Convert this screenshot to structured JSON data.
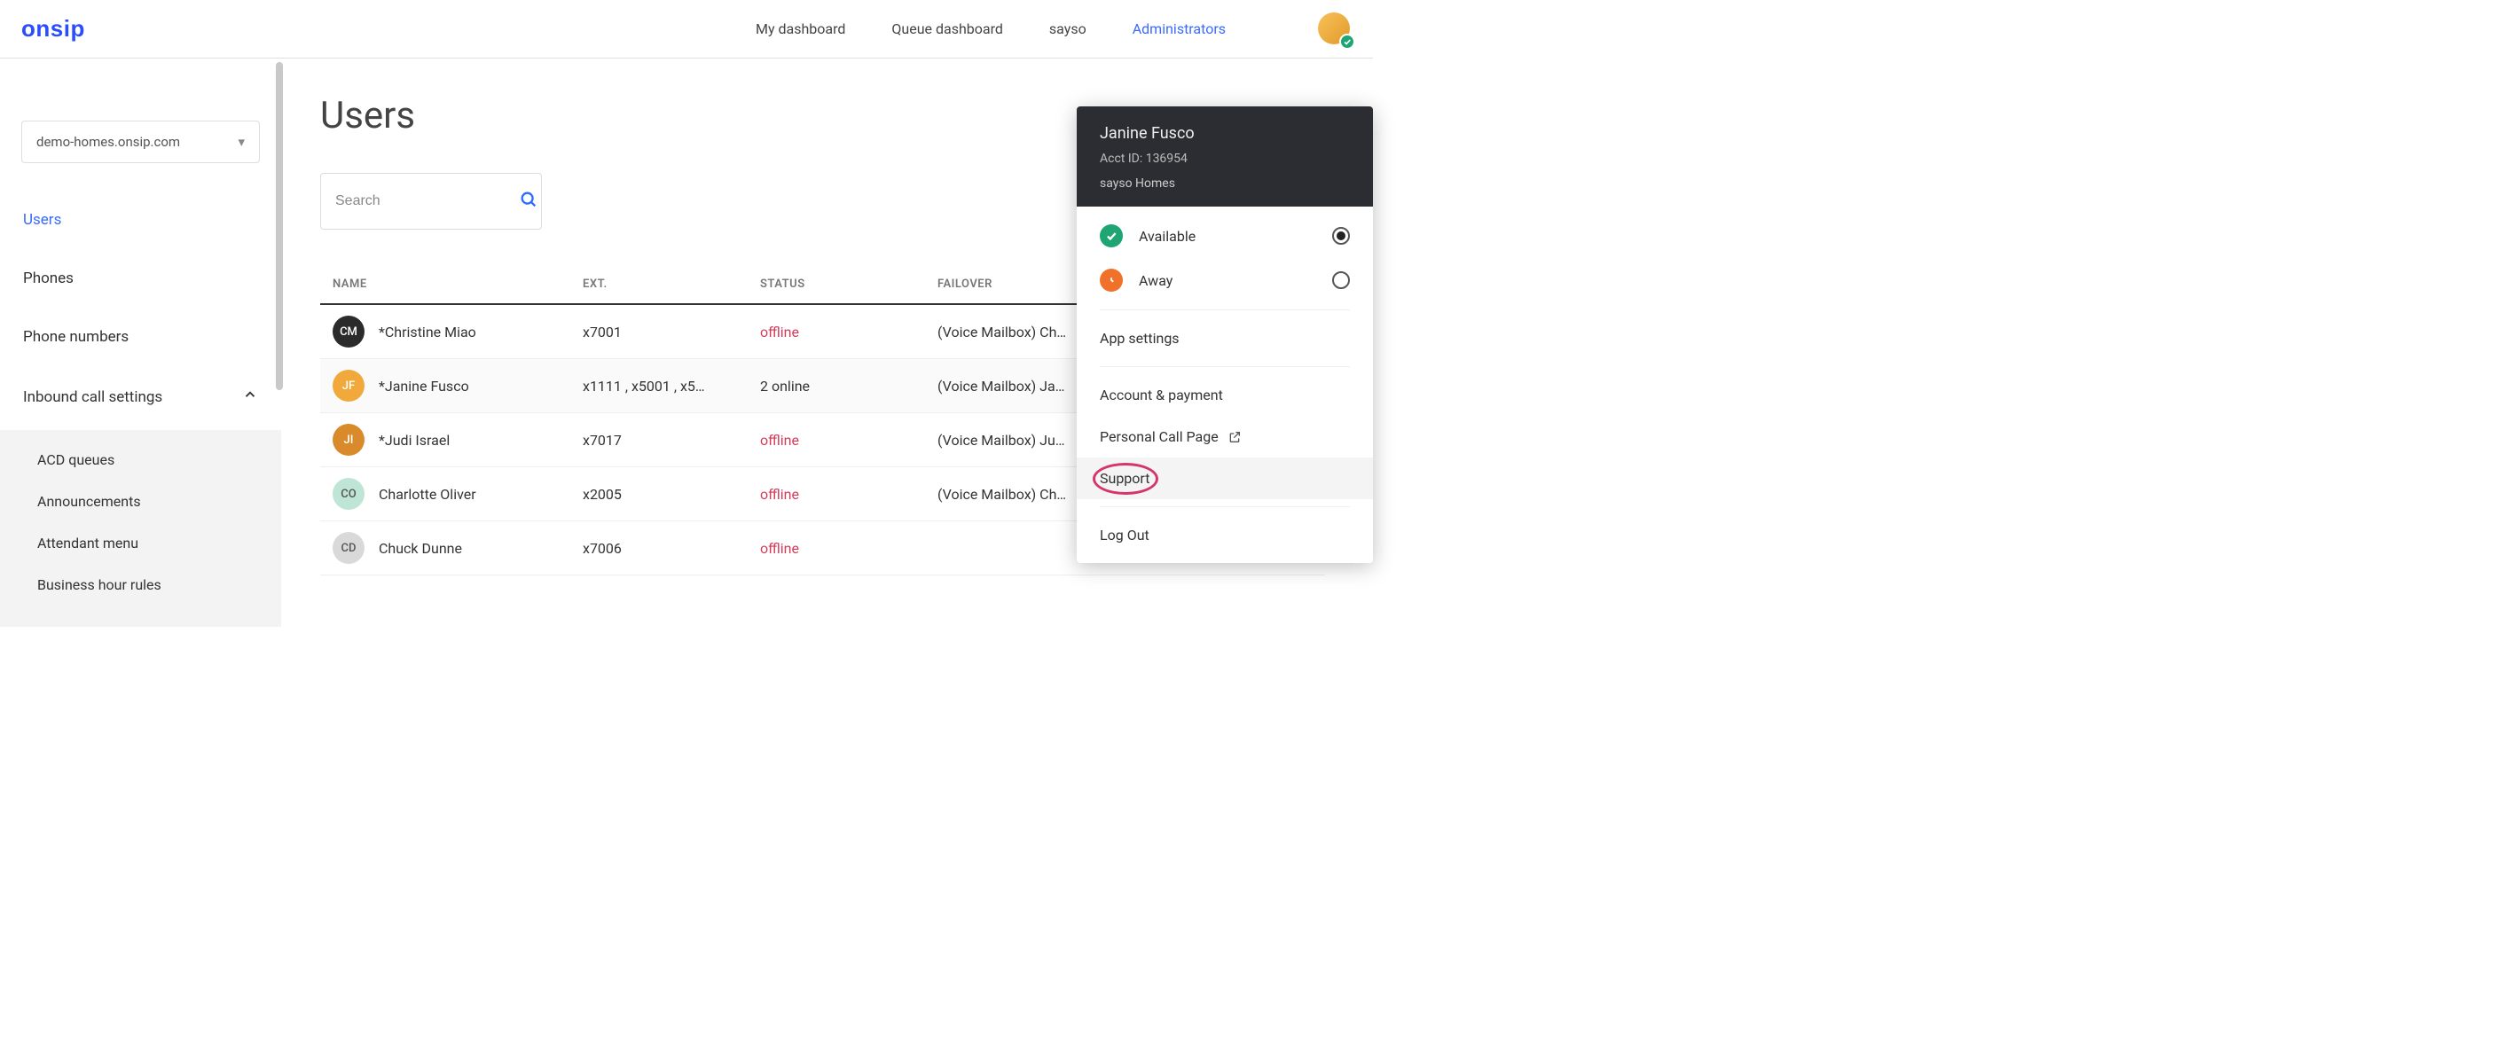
{
  "header": {
    "logo": "onsip",
    "nav": [
      "My dashboard",
      "Queue dashboard",
      "sayso",
      "Administrators"
    ],
    "nav_active_index": 3
  },
  "sidebar": {
    "domain": "demo-homes.onsip.com",
    "items": [
      {
        "label": "Users",
        "active": true
      },
      {
        "label": "Phones"
      },
      {
        "label": "Phone numbers"
      },
      {
        "label": "Inbound call settings",
        "expanded": true
      }
    ],
    "sub_items": [
      "ACD queues",
      "Announcements",
      "Attendant menu",
      "Business hour rules"
    ]
  },
  "main": {
    "title": "Users",
    "search_placeholder": "Search",
    "columns": [
      "NAME",
      "EXT.",
      "STATUS",
      "FAILOVER"
    ],
    "rows": [
      {
        "initials": "CM",
        "color": "#2b2b2b",
        "name": "*Christine Miao",
        "ext": "x7001",
        "status": "offline",
        "status_class": "offline",
        "failover": "(Voice Mailbox) Ch…",
        "actions": false
      },
      {
        "initials": "JF",
        "color": "#f0a93a",
        "name": "*Janine Fusco",
        "ext": "x1111 ,  x5001 ,  x5…",
        "status": "2 online",
        "status_class": "online",
        "failover": "(Voice Mailbox) Ja…",
        "actions": false
      },
      {
        "initials": "JI",
        "color": "#d98a2b",
        "name": "*Judi Israel",
        "ext": "x7017",
        "status": "offline",
        "status_class": "offline",
        "failover": "(Voice Mailbox) Ju…",
        "actions": false
      },
      {
        "initials": "CO",
        "color": "#bfe5d6",
        "name": "Charlotte Oliver",
        "ext": "x2005",
        "status": "offline",
        "status_class": "offline",
        "failover": "(Voice Mailbox) Ch…",
        "actions": true,
        "initials_dark": true
      },
      {
        "initials": "CD",
        "color": "#d9d9d9",
        "name": "Chuck Dunne",
        "ext": "x7006",
        "status": "offline",
        "status_class": "offline",
        "failover": "",
        "actions": true,
        "initials_dark": true
      }
    ]
  },
  "panel": {
    "name": "Janine Fusco",
    "acct": "Acct ID: 136954",
    "org": "sayso Homes",
    "status_available": "Available",
    "status_away": "Away",
    "items": {
      "app_settings": "App settings",
      "account_payment": "Account & payment",
      "personal_call": "Personal Call Page",
      "support": "Support",
      "logout": "Log Out"
    }
  }
}
